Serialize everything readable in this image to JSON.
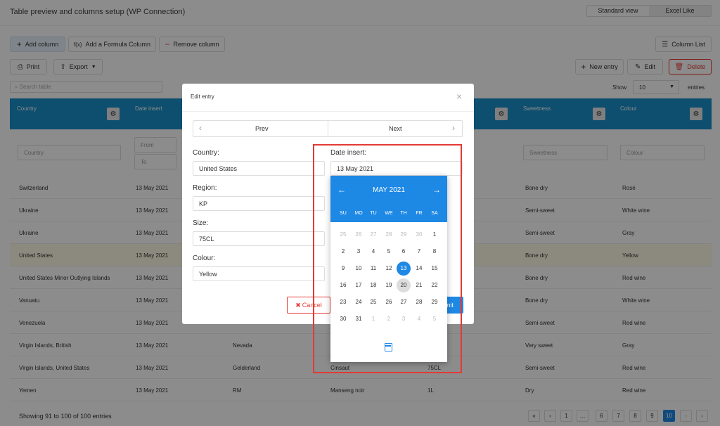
{
  "page": {
    "title": "Table preview and columns setup (WP Connection)"
  },
  "view_toggle": {
    "standard": "Standard view",
    "excel": "Excel Like"
  },
  "toolbar": {
    "add_column": "Add column",
    "formula_icon": "f(x)",
    "add_formula": "Add a Formula Column",
    "remove_column": "Remove column",
    "column_list": "Column List",
    "print": "Print",
    "export": "Export",
    "new_entry": "New entry",
    "edit": "Edit",
    "delete": "Delete"
  },
  "search": {
    "placeholder": "Search table"
  },
  "show": {
    "label": "Show",
    "value": "10",
    "suffix": "entries"
  },
  "columns": {
    "country": "Country",
    "date_insert": "Date insert",
    "sweetness": "Sweetness",
    "colour": "Colour"
  },
  "filters": {
    "country": "Country",
    "from": "From",
    "to": "To",
    "sweetness": "Sweetness",
    "colour": "Colour"
  },
  "rows": [
    {
      "country": "Switzerland",
      "date": "13 May 2021",
      "c3": "",
      "c4": "",
      "c5": "",
      "sweetness": "Bone dry",
      "colour": "Rosé"
    },
    {
      "country": "Ukraine",
      "date": "13 May 2021",
      "c3": "",
      "c4": "",
      "c5": "",
      "sweetness": "Semi-sweet",
      "colour": "White wine"
    },
    {
      "country": "Ukraine",
      "date": "13 May 2021",
      "c3": "",
      "c4": "",
      "c5": "",
      "sweetness": "Semi-sweet",
      "colour": "Gray"
    },
    {
      "country": "United States",
      "date": "13 May 2021",
      "c3": "",
      "c4": "",
      "c5": "",
      "sweetness": "Bone dry",
      "colour": "Yellow"
    },
    {
      "country": "United States Minor Outlying Islands",
      "date": "13 May 2021",
      "c3": "",
      "c4": "",
      "c5": "",
      "sweetness": "Bone dry",
      "colour": "Red wine"
    },
    {
      "country": "Vanuatu",
      "date": "13 May 2021",
      "c3": "",
      "c4": "",
      "c5": "",
      "sweetness": "Bone dry",
      "colour": "White wine"
    },
    {
      "country": "Venezuela",
      "date": "13 May 2021",
      "c3": "",
      "c4": "",
      "c5": "",
      "sweetness": "Semi-sweet",
      "colour": "Red wine"
    },
    {
      "country": "Virgin Islands, British",
      "date": "13 May 2021",
      "c3": "Nevada",
      "c4": "",
      "c5": "",
      "sweetness": "Very sweet",
      "colour": "Gray"
    },
    {
      "country": "Virgin Islands, United States",
      "date": "13 May 2021",
      "c3": "Gelderland",
      "c4": "Cinsaut",
      "c5": "75CL",
      "sweetness": "Semi-sweet",
      "colour": "Red wine"
    },
    {
      "country": "Yemen",
      "date": "13 May 2021",
      "c3": "RM",
      "c4": "Manseng noir",
      "c5": "1L",
      "sweetness": "Dry",
      "colour": "Red wine"
    }
  ],
  "footer": {
    "info": "Showing 91 to 100 of 100 entries"
  },
  "pagination": [
    "«",
    "‹",
    "1",
    "…",
    "6",
    "7",
    "8",
    "9",
    "10",
    "›",
    "»"
  ],
  "modal": {
    "title": "Edit entry",
    "close": "×",
    "prev": "Prev",
    "next": "Next",
    "country_label": "Country:",
    "country_value": "United States",
    "region_label": "Region:",
    "region_value": "KP",
    "size_label": "Size:",
    "size_value": "75CL",
    "colour_label": "Colour:",
    "colour_value": "Yellow",
    "date_label": "Date insert:",
    "date_value": "13 May 2021",
    "cancel": "Cancel",
    "submit": "mit"
  },
  "calendar": {
    "month": "MAY 2021",
    "prev_arrow": "←",
    "next_arrow": "→",
    "weekdays": [
      "SU",
      "MO",
      "TU",
      "WE",
      "TH",
      "FR",
      "SA"
    ],
    "weeks": [
      [
        "25",
        "26",
        "27",
        "28",
        "29",
        "30",
        "1"
      ],
      [
        "2",
        "3",
        "4",
        "5",
        "6",
        "7",
        "8"
      ],
      [
        "9",
        "10",
        "11",
        "12",
        "13",
        "14",
        "15"
      ],
      [
        "16",
        "17",
        "18",
        "19",
        "20",
        "21",
        "22"
      ],
      [
        "23",
        "24",
        "25",
        "26",
        "27",
        "28",
        "29"
      ],
      [
        "30",
        "31",
        "1",
        "2",
        "3",
        "4",
        "5"
      ]
    ],
    "selected": "13",
    "today": "20"
  },
  "colors": {
    "accent": "#1e88e5",
    "header": "#1a8fc8",
    "danger": "#e53935",
    "highlight_box": "#e53935"
  }
}
